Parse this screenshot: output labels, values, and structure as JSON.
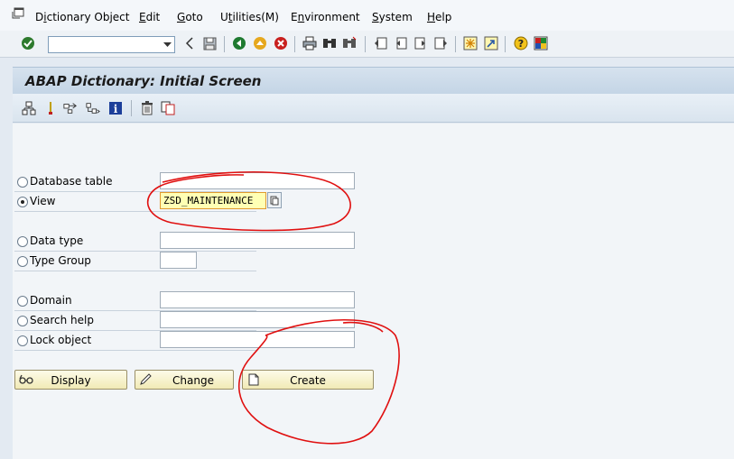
{
  "menu": {
    "items": [
      "Dictionary Object",
      "Edit",
      "Goto",
      "Utilities(M)",
      "Environment",
      "System",
      "Help"
    ],
    "mnemonics": [
      "i",
      "E",
      "G",
      "t",
      "n",
      "S",
      "H"
    ]
  },
  "toolbar": {
    "command_field_value": "",
    "icons": [
      "enter-icon",
      "command-field",
      "back-arrow-icon",
      "save-icon",
      "back-icon",
      "exit-icon",
      "cancel-icon",
      "print-icon",
      "find-icon",
      "find-next-icon",
      "first-page-icon",
      "previous-page-icon",
      "next-page-icon",
      "last-page-icon",
      "create-session-icon",
      "shortcut-icon",
      "help-icon",
      "layout-menu-icon"
    ]
  },
  "header": {
    "title": "ABAP Dictionary: Initial Screen"
  },
  "app_toolbar": {
    "icons": [
      "hierarchy-icon",
      "where-used-icon",
      "display-object-list-icon",
      "other-object-icon",
      "information-icon",
      "delete-icon",
      "copy-icon"
    ]
  },
  "form": {
    "options": [
      {
        "label": "Database table",
        "selected": false,
        "value": ""
      },
      {
        "label": "View",
        "selected": true,
        "value": "ZSD_MAINTENANCE"
      },
      {
        "label": "Data type",
        "selected": false,
        "value": ""
      },
      {
        "label": "Type Group",
        "selected": false,
        "value": ""
      },
      {
        "label": "Domain",
        "selected": false,
        "value": ""
      },
      {
        "label": "Search help",
        "selected": false,
        "value": ""
      },
      {
        "label": "Lock object",
        "selected": false,
        "value": ""
      }
    ]
  },
  "buttons": {
    "display": "Display",
    "change": "Change",
    "create": "Create"
  },
  "annotations": {
    "color": "#e01010",
    "marks": [
      "circle-around-view-field",
      "circle-around-create-button"
    ]
  },
  "colors": {
    "active_field_bg": "#ffffb4",
    "button_bg": "#f1eab5",
    "title_bg": "#c4d5e6"
  }
}
